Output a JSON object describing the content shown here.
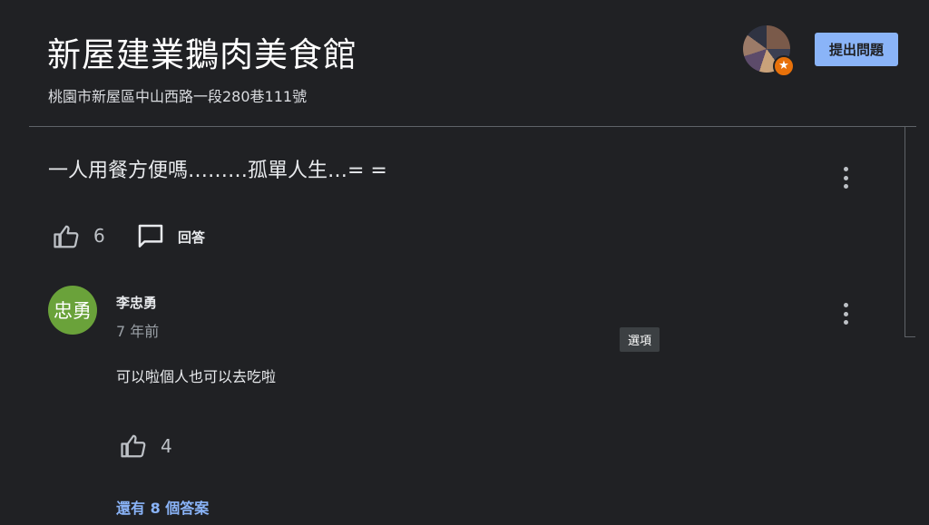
{
  "header": {
    "title": "新屋建業鵝肉美食館",
    "address": "桃園市新屋區中山西路一段280巷111號",
    "ask_button_label": "提出問題",
    "profile_badge_icon": "★"
  },
  "question": {
    "text": "一人用餐方便嗎………孤單人生…= =",
    "like_count": "6",
    "reply_label": "回答"
  },
  "answer": {
    "avatar_text": "忠勇",
    "avatar_color": "#6aa23a",
    "author": "李忠勇",
    "time_ago": "7 年前",
    "text": "可以啦個人也可以去吃啦",
    "like_count": "4"
  },
  "tooltip": {
    "text": "選項"
  },
  "more_answers_label": "還有 8 個答案",
  "colors": {
    "background": "#202124",
    "accent": "#8ab4f8",
    "badge": "#e8710a"
  }
}
